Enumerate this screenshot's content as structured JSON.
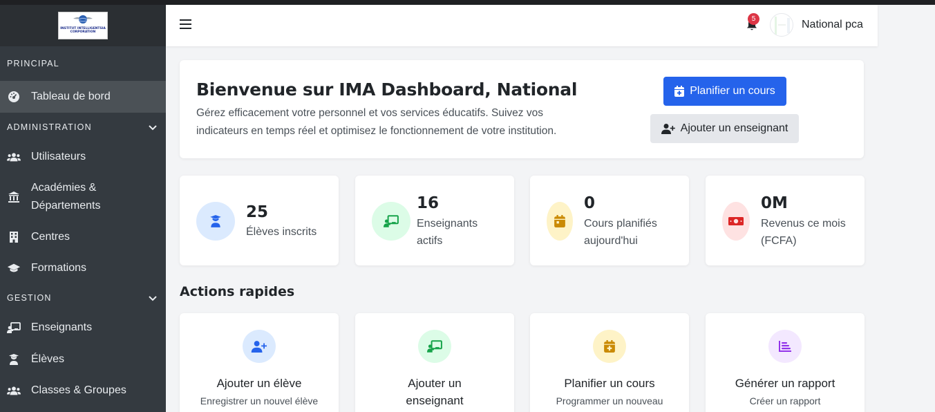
{
  "sidebar": {
    "logo_text": "INSTITUT INTELLIGENTSIA CORPORATION",
    "principal_label": "PRINCIPAL",
    "dashboard_label": "Tableau de bord",
    "admin_label": "ADMINISTRATION",
    "users_label": "Utilisateurs",
    "academies_line1": "Académies &",
    "academies_line2": "Départements",
    "centres_label": "Centres",
    "formations_label": "Formations",
    "gestion_label": "GESTION",
    "enseignants_label": "Enseignants",
    "eleves_label": "Élèves",
    "classes_label": "Classes & Groupes"
  },
  "topbar": {
    "notif_count": "5",
    "user_name": "National pca"
  },
  "welcome": {
    "title": "Bienvenue sur IMA Dashboard, National",
    "line1": "Gérez efficacement votre personnel et vos services éducatifs. Suivez vos",
    "line2": "indicateurs en temps réel et optimisez le fonctionnement de votre institution.",
    "plan_button": "Planifier un cours",
    "add_teacher_button": "Ajouter un enseignant"
  },
  "stats": [
    {
      "value": "25",
      "label": "Élèves inscrits",
      "color": "#dbeafe",
      "icon_color": "#2563eb"
    },
    {
      "value": "16",
      "label": "Enseignants actifs",
      "color": "#dcfce7",
      "icon_color": "#16a34a"
    },
    {
      "value": "0",
      "label": "Cours planifiés aujourd'hui",
      "color": "#fef3c7",
      "icon_color": "#ca8a04"
    },
    {
      "value": "0M",
      "label": "Revenus ce mois (FCFA)",
      "color": "#fee2e2",
      "icon_color": "#dc2626"
    }
  ],
  "quick_actions": {
    "title": "Actions rapides",
    "items": [
      {
        "title": "Ajouter un élève",
        "desc": "Enregistrer un nouvel élève"
      },
      {
        "title": "Ajouter un enseignant",
        "desc": ""
      },
      {
        "title": "Planifier un cours",
        "desc": "Programmer un nouveau"
      },
      {
        "title": "Générer un rapport",
        "desc": "Créer un rapport"
      }
    ]
  },
  "colors": {
    "sidebar_bg": "#343a40",
    "primary": "#2563eb",
    "badge": "#dc3545"
  }
}
